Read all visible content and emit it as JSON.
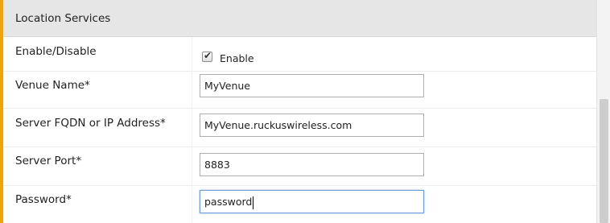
{
  "section": {
    "title": "Location Services",
    "accent_color": "#f0a30a"
  },
  "enable": {
    "label": "Enable/Disable",
    "checkbox_label": "Enable",
    "checked": true
  },
  "venue_name": {
    "label": "Venue Name*",
    "value": "MyVenue"
  },
  "server_address": {
    "label": "Server FQDN or IP Address*",
    "value": "MyVenue.ruckuswireless.com"
  },
  "server_port": {
    "label": "Server Port*",
    "value": "8883"
  },
  "password": {
    "label": "Password*",
    "value": "password"
  }
}
